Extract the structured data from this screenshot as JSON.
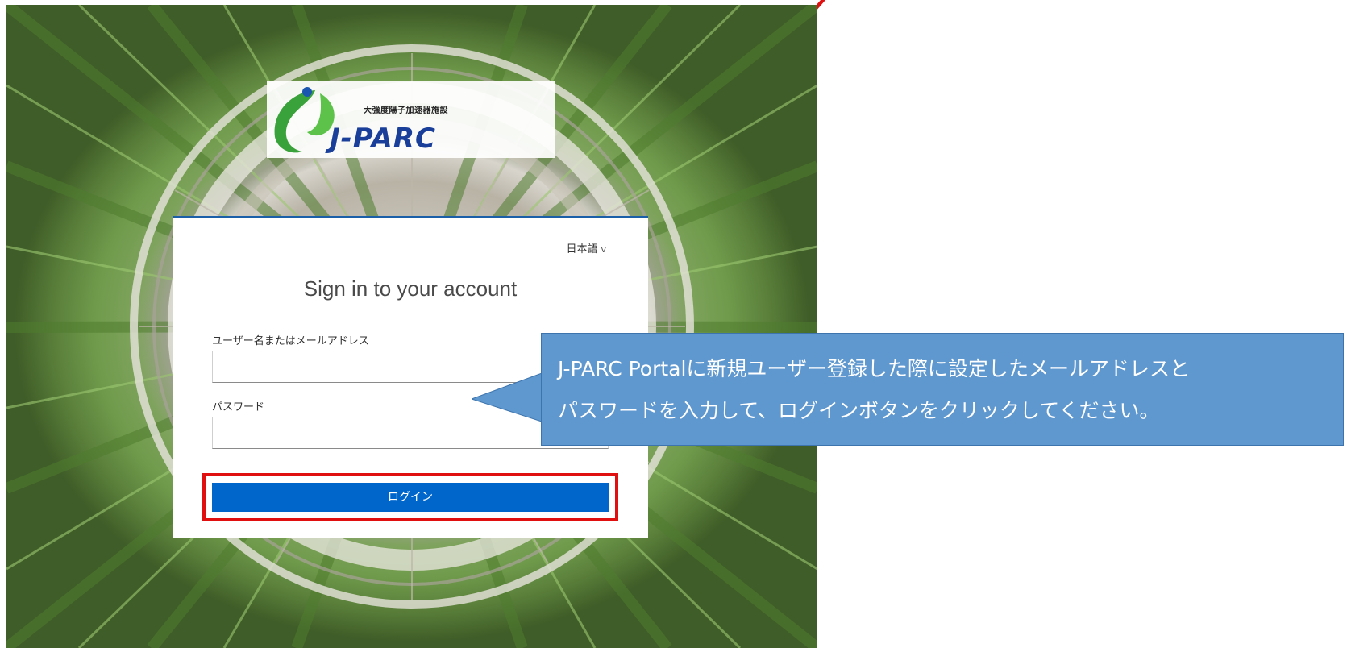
{
  "logo": {
    "jp_text": "大強度陽子加速器施設",
    "name": "J-PARC"
  },
  "login": {
    "language": "日本語",
    "title": "Sign in to your account",
    "username_label": "ユーザー名またはメールアドレス",
    "password_label": "パスワード",
    "login_button": "ログイン"
  },
  "callout": {
    "line1": "J-PARC Portalに新規ユーザー登録した際に設定したメールアドレスと",
    "line2": "パスワードを入力して、ログインボタンをクリックしてください。"
  },
  "colors": {
    "accent_blue": "#0066cc",
    "callout_blue": "#5f97cf",
    "highlight_red": "#e01010"
  },
  "icons": {
    "language_chevron": "chevron-down-icon"
  }
}
